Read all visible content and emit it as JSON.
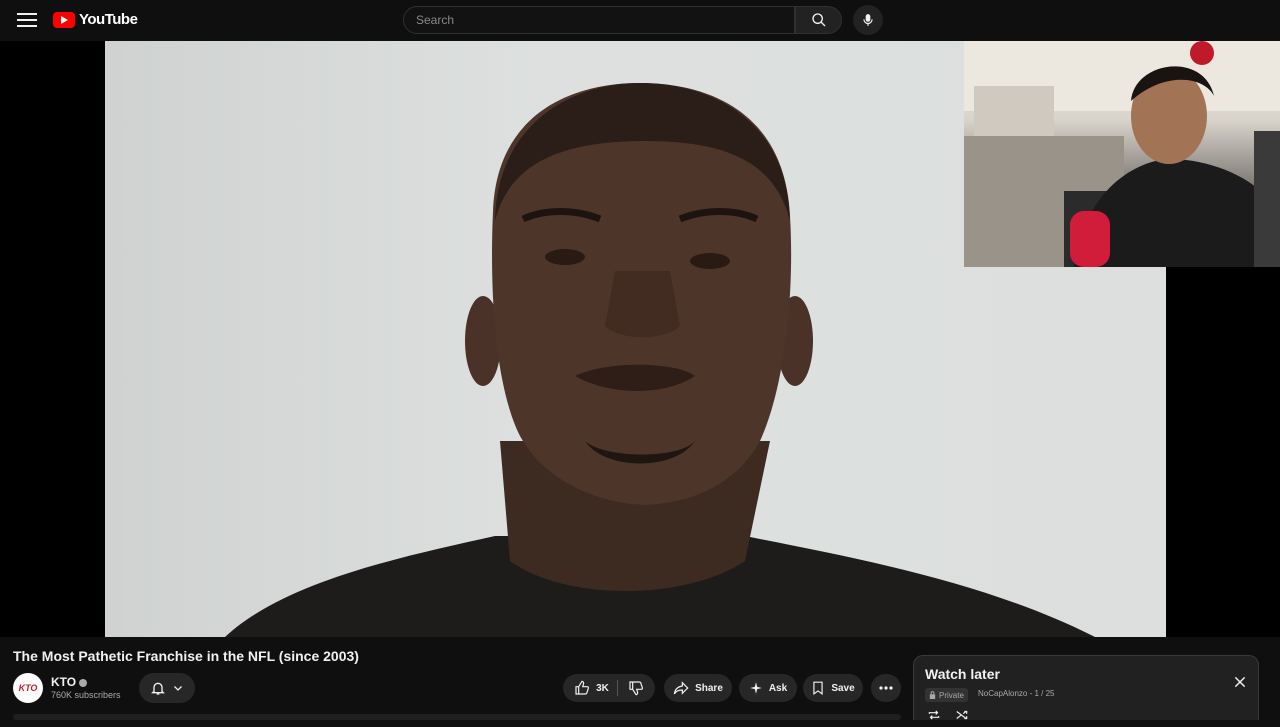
{
  "header": {
    "logo_text": "YouTube",
    "search_placeholder": "Search"
  },
  "video": {
    "title": "The Most Pathetic Franchise in the NFL (since 2003)"
  },
  "channel": {
    "name": "KTO",
    "subscribers": "760K subscribers",
    "avatar_text": "KTO"
  },
  "actions": {
    "like_count": "3K",
    "share_label": "Share",
    "ask_label": "Ask",
    "save_label": "Save"
  },
  "playlist": {
    "title": "Watch later",
    "privacy": "Private",
    "meta": "NoCapAlonzo - 1 / 25"
  },
  "colors": {
    "brand_red": "#ff0000",
    "background": "#0f0f0f",
    "pill": "#272727"
  },
  "icons": [
    "menu-icon",
    "youtube-logo-icon",
    "search-icon",
    "mic-icon",
    "bell-icon",
    "chevron-down-icon",
    "like-icon",
    "dislike-icon",
    "share-icon",
    "ask-sparkle-icon",
    "save-icon",
    "more-icon",
    "lock-icon",
    "close-icon",
    "loop-icon",
    "shuffle-icon"
  ]
}
